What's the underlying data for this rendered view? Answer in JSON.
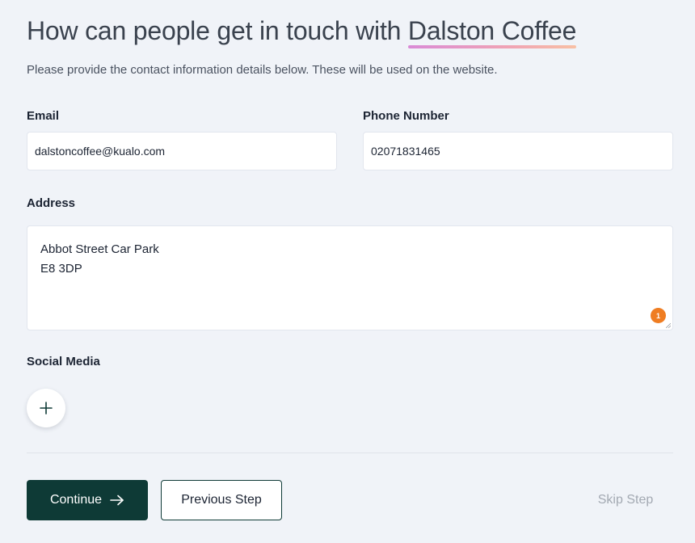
{
  "header": {
    "title_prefix": "How can people get in touch with ",
    "business_name": "Dalston Coffee",
    "subtitle": "Please provide the contact information details below. These will be used on the website."
  },
  "form": {
    "email": {
      "label": "Email",
      "value": "dalstoncoffee@kualo.com"
    },
    "phone": {
      "label": "Phone Number",
      "value": "02071831465"
    },
    "address": {
      "label": "Address",
      "lines": [
        "Abbot Street Car Park",
        "E8 3DP"
      ],
      "badge_count": "1"
    },
    "social": {
      "label": "Social Media",
      "add_icon": "plus-icon"
    }
  },
  "actions": {
    "continue_label": "Continue",
    "continue_icon": "arrow-right-icon",
    "previous_label": "Previous Step",
    "skip_label": "Skip Step"
  },
  "colors": {
    "primary": "#0e3a36",
    "badge": "#ef7d22",
    "background": "#f0f3f8",
    "muted_text": "#a3a9b2"
  }
}
